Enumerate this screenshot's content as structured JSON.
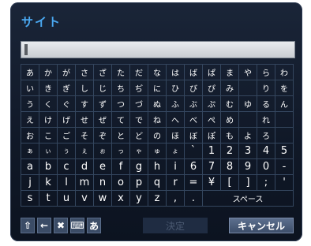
{
  "dialog": {
    "title": "サイト"
  },
  "input": {
    "value": ""
  },
  "keyboard": {
    "rows": [
      [
        "あ",
        "か",
        "が",
        "さ",
        "ざ",
        "た",
        "だ",
        "な",
        "は",
        "ば",
        "ぱ",
        "ま",
        "や",
        "ら",
        "わ"
      ],
      [
        "い",
        "き",
        "ぎ",
        "し",
        "じ",
        "ち",
        "ぢ",
        "に",
        "ひ",
        "び",
        "ぴ",
        "み",
        "",
        "り",
        "を"
      ],
      [
        "う",
        "く",
        "ぐ",
        "す",
        "ず",
        "つ",
        "づ",
        "ぬ",
        "ふ",
        "ぶ",
        "ぷ",
        "む",
        "ゆ",
        "る",
        "ん"
      ],
      [
        "え",
        "け",
        "げ",
        "せ",
        "ぜ",
        "て",
        "で",
        "ね",
        "へ",
        "べ",
        "ぺ",
        "め",
        "",
        "れ",
        ""
      ],
      [
        "お",
        "こ",
        "ご",
        "そ",
        "ぞ",
        "と",
        "ど",
        "の",
        "ほ",
        "ぼ",
        "ぽ",
        "も",
        "よ",
        "ろ",
        ""
      ],
      [
        "ぁ",
        "ぃ",
        "ぅ",
        "ぇ",
        "ぉ",
        "っ",
        "ゃ",
        "ゅ",
        "ょ",
        "`",
        "1",
        "2",
        "3",
        "4",
        "5"
      ],
      [
        "a",
        "b",
        "c",
        "d",
        "e",
        "f",
        "g",
        "h",
        "i",
        "6",
        "7",
        "8",
        "9",
        "0",
        "-"
      ],
      [
        "j",
        "k",
        "l",
        "m",
        "n",
        "o",
        "p",
        "q",
        "r",
        "=",
        "¥",
        "[",
        "]",
        ";",
        "'"
      ],
      [
        "s",
        "t",
        "u",
        "v",
        "w",
        "x",
        "y",
        "z",
        ",",
        "."
      ]
    ],
    "space_label": "スペース"
  },
  "toolbar": {
    "shift_glyph": "⇧",
    "backspace_glyph": "←",
    "delete_glyph": "✖",
    "keyboard_glyph": "⌨",
    "mode_label": "あ",
    "ok_label": "決定",
    "cancel_label": "キャンセル"
  }
}
